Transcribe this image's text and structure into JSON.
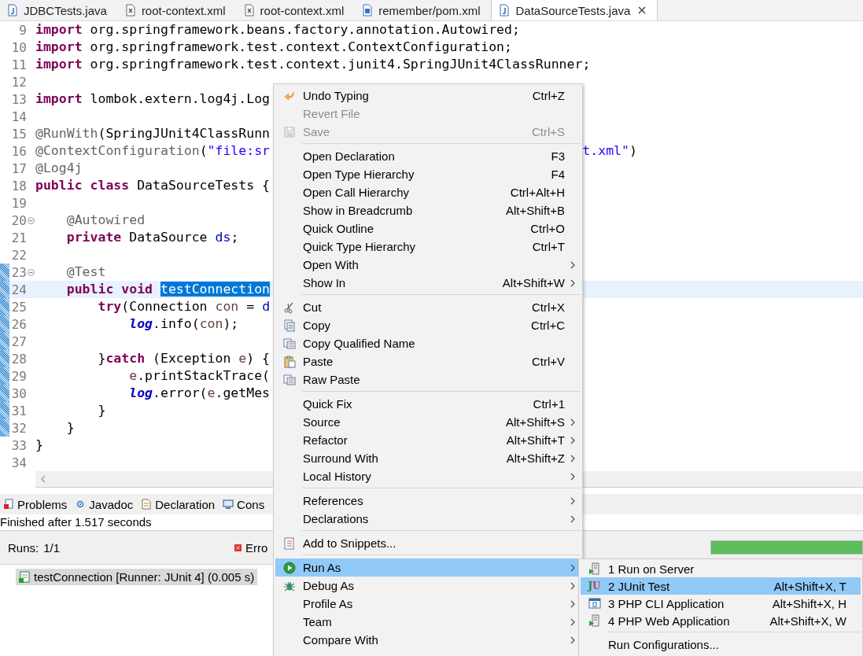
{
  "editor_tabs": [
    {
      "label": "JDBCTests.java",
      "kind": "java",
      "selected": false
    },
    {
      "label": "root-context.xml",
      "kind": "xml",
      "selected": false
    },
    {
      "label": "root-context.xml",
      "kind": "xml",
      "selected": false
    },
    {
      "label": "remember/pom.xml",
      "kind": "maven",
      "selected": false
    },
    {
      "label": "DataSourceTests.java",
      "kind": "java",
      "selected": true
    }
  ],
  "code_lines": [
    {
      "number": "9",
      "changed": false,
      "fold": false,
      "current": false,
      "tokens": [
        {
          "kind": "keyword",
          "text": "import"
        },
        {
          "kind": "plain",
          "text": " org.springframework.beans.factory.annotation.Autowired;"
        }
      ]
    },
    {
      "number": "10",
      "changed": false,
      "fold": false,
      "current": false,
      "tokens": [
        {
          "kind": "keyword",
          "text": "import"
        },
        {
          "kind": "plain",
          "text": " org.springframework.test.context.ContextConfiguration;"
        }
      ]
    },
    {
      "number": "11",
      "changed": false,
      "fold": false,
      "current": false,
      "tokens": [
        {
          "kind": "keyword",
          "text": "import"
        },
        {
          "kind": "plain",
          "text": " org.springframework.test.context.junit4.SpringJUnit4ClassRunner;"
        }
      ]
    },
    {
      "number": "12",
      "changed": false,
      "fold": false,
      "current": false
    },
    {
      "number": "13",
      "changed": false,
      "fold": false,
      "current": false,
      "tokens": [
        {
          "kind": "keyword",
          "text": "import"
        },
        {
          "kind": "plain",
          "text": " lombok.extern.log4j.Log"
        }
      ]
    },
    {
      "number": "14",
      "changed": false,
      "fold": false,
      "current": false
    },
    {
      "number": "15",
      "changed": false,
      "fold": false,
      "current": false,
      "tokens": [
        {
          "kind": "annotation",
          "text": "@RunWith"
        },
        {
          "kind": "plain",
          "text": "(SpringJUnit4ClassRunn"
        }
      ]
    },
    {
      "number": "16",
      "changed": false,
      "fold": false,
      "current": false,
      "tokens": [
        {
          "kind": "annotation",
          "text": "@ContextConfiguration"
        },
        {
          "kind": "plain",
          "text": "("
        },
        {
          "kind": "string",
          "text": "\"file:sr"
        }
      ],
      "tail": [
        {
          "kind": "string",
          "text": "t.xml\""
        },
        {
          "kind": "plain",
          "text": ")"
        }
      ]
    },
    {
      "number": "17",
      "changed": false,
      "fold": false,
      "current": false,
      "tokens": [
        {
          "kind": "annotation",
          "text": "@Log4j"
        }
      ]
    },
    {
      "number": "18",
      "changed": false,
      "fold": false,
      "current": false,
      "tokens": [
        {
          "kind": "keyword",
          "text": "public"
        },
        {
          "kind": "keyword",
          "text": " class"
        },
        {
          "kind": "plain",
          "text": " DataSourceTests {"
        }
      ]
    },
    {
      "number": "19",
      "changed": false,
      "fold": false,
      "current": false
    },
    {
      "number": "20",
      "changed": false,
      "fold": true,
      "current": false,
      "tokens": [
        {
          "kind": "annotation",
          "text": "    @Autowired"
        }
      ]
    },
    {
      "number": "21",
      "changed": false,
      "fold": false,
      "current": false,
      "tokens": [
        {
          "kind": "keyword",
          "text": "    private"
        },
        {
          "kind": "plain",
          "text": " DataSource "
        },
        {
          "kind": "field",
          "text": "ds"
        },
        {
          "kind": "plain",
          "text": ";"
        }
      ]
    },
    {
      "number": "22",
      "changed": false,
      "fold": false,
      "current": false
    },
    {
      "number": "23",
      "changed": true,
      "fold": true,
      "current": false,
      "tokens": [
        {
          "kind": "annotation",
          "text": "    @Test"
        }
      ]
    },
    {
      "number": "24",
      "changed": true,
      "fold": false,
      "current": true,
      "tokens": [
        {
          "kind": "keyword",
          "text": "    public"
        },
        {
          "kind": "keyword",
          "text": " void "
        },
        {
          "kind": "selection",
          "text": "testConnection"
        }
      ]
    },
    {
      "number": "25",
      "changed": true,
      "fold": false,
      "current": false,
      "tokens": [
        {
          "kind": "keyword",
          "text": "        try"
        },
        {
          "kind": "plain",
          "text": "(Connection "
        },
        {
          "kind": "variable",
          "text": "con"
        },
        {
          "kind": "plain",
          "text": " = "
        },
        {
          "kind": "field",
          "text": "d"
        }
      ]
    },
    {
      "number": "26",
      "changed": true,
      "fold": false,
      "current": false,
      "tokens": [
        {
          "kind": "static",
          "text": "            log"
        },
        {
          "kind": "plain",
          "text": ".info("
        },
        {
          "kind": "variable",
          "text": "con"
        },
        {
          "kind": "plain",
          "text": ");"
        }
      ]
    },
    {
      "number": "27",
      "changed": true,
      "fold": false,
      "current": false
    },
    {
      "number": "28",
      "changed": true,
      "fold": false,
      "current": false,
      "tokens": [
        {
          "kind": "plain",
          "text": "        }"
        },
        {
          "kind": "keyword",
          "text": "catch"
        },
        {
          "kind": "plain",
          "text": " (Exception "
        },
        {
          "kind": "variable",
          "text": "e"
        },
        {
          "kind": "plain",
          "text": ") {"
        }
      ]
    },
    {
      "number": "29",
      "changed": true,
      "fold": false,
      "current": false,
      "tokens": [
        {
          "kind": "variable",
          "text": "            e"
        },
        {
          "kind": "plain",
          "text": ".printStackTrace("
        }
      ]
    },
    {
      "number": "30",
      "changed": true,
      "fold": false,
      "current": false,
      "tokens": [
        {
          "kind": "static",
          "text": "            log"
        },
        {
          "kind": "plain",
          "text": ".error("
        },
        {
          "kind": "variable",
          "text": "e"
        },
        {
          "kind": "plain",
          "text": ".getMes"
        }
      ]
    },
    {
      "number": "31",
      "changed": true,
      "fold": false,
      "current": false,
      "tokens": [
        {
          "kind": "plain",
          "text": "        }"
        }
      ]
    },
    {
      "number": "32",
      "changed": true,
      "fold": false,
      "current": false,
      "tokens": [
        {
          "kind": "plain",
          "text": "    }"
        }
      ]
    },
    {
      "number": "33",
      "changed": false,
      "fold": false,
      "current": false,
      "tokens": [
        {
          "kind": "plain",
          "text": "}"
        }
      ]
    },
    {
      "number": "34",
      "changed": false,
      "fold": false,
      "current": false
    }
  ],
  "panel_tabs": [
    {
      "label": "Problems",
      "kind": "problems"
    },
    {
      "label": "Javadoc",
      "kind": "javadoc"
    },
    {
      "label": "Declaration",
      "kind": "declaration"
    },
    {
      "label": "Cons",
      "kind": "console"
    }
  ],
  "junit": {
    "status": "Finished after 1.517 seconds",
    "runs_label": "Runs:",
    "runs_value": "1/1",
    "errors_label": "Erro",
    "progress": {
      "level": 1
    },
    "results": [
      {
        "label": "testConnection [Runner: JUnit 4] (0.005 s)",
        "selected": true
      }
    ]
  },
  "context_menu": [
    {
      "kind": "item",
      "label": "Undo Typing",
      "shortcut": "Ctrl+Z",
      "disabled": false,
      "submenu": false,
      "selected": false
    },
    {
      "kind": "item",
      "label": "Revert File",
      "disabled": true,
      "submenu": false,
      "selected": false
    },
    {
      "kind": "item",
      "label": "Save",
      "shortcut": "Ctrl+S",
      "disabled": true,
      "submenu": false,
      "selected": false
    },
    {
      "kind": "separator"
    },
    {
      "kind": "item",
      "label": "Open Declaration",
      "shortcut": "F3",
      "disabled": false,
      "submenu": false,
      "selected": false
    },
    {
      "kind": "item",
      "label": "Open Type Hierarchy",
      "shortcut": "F4",
      "disabled": false,
      "submenu": false,
      "selected": false
    },
    {
      "kind": "item",
      "label": "Open Call Hierarchy",
      "shortcut": "Ctrl+Alt+H",
      "disabled": false,
      "submenu": false,
      "selected": false
    },
    {
      "kind": "item",
      "label": "Show in Breadcrumb",
      "shortcut": "Alt+Shift+B",
      "disabled": false,
      "submenu": false,
      "selected": false
    },
    {
      "kind": "item",
      "label": "Quick Outline",
      "shortcut": "Ctrl+O",
      "disabled": false,
      "submenu": false,
      "selected": false
    },
    {
      "kind": "item",
      "label": "Quick Type Hierarchy",
      "shortcut": "Ctrl+T",
      "disabled": false,
      "submenu": false,
      "selected": false
    },
    {
      "kind": "item",
      "label": "Open With",
      "disabled": false,
      "submenu": true,
      "selected": false
    },
    {
      "kind": "item",
      "label": "Show In",
      "shortcut": "Alt+Shift+W",
      "disabled": false,
      "submenu": true,
      "selected": false
    },
    {
      "kind": "separator"
    },
    {
      "kind": "item",
      "label": "Cut",
      "shortcut": "Ctrl+X",
      "disabled": false,
      "submenu": false,
      "selected": false
    },
    {
      "kind": "item",
      "label": "Copy",
      "shortcut": "Ctrl+C",
      "disabled": false,
      "submenu": false,
      "selected": false
    },
    {
      "kind": "item",
      "label": "Copy Qualified Name",
      "disabled": false,
      "submenu": false,
      "selected": false
    },
    {
      "kind": "item",
      "label": "Paste",
      "shortcut": "Ctrl+V",
      "disabled": false,
      "submenu": false,
      "selected": false
    },
    {
      "kind": "item",
      "label": "Raw Paste",
      "disabled": false,
      "submenu": false,
      "selected": false
    },
    {
      "kind": "separator"
    },
    {
      "kind": "item",
      "label": "Quick Fix",
      "shortcut": "Ctrl+1",
      "disabled": false,
      "submenu": false,
      "selected": false
    },
    {
      "kind": "item",
      "label": "Source",
      "shortcut": "Alt+Shift+S",
      "disabled": false,
      "submenu": true,
      "selected": false
    },
    {
      "kind": "item",
      "label": "Refactor",
      "shortcut": "Alt+Shift+T",
      "disabled": false,
      "submenu": true,
      "selected": false
    },
    {
      "kind": "item",
      "label": "Surround With",
      "shortcut": "Alt+Shift+Z",
      "disabled": false,
      "submenu": true,
      "selected": false
    },
    {
      "kind": "item",
      "label": "Local History",
      "disabled": false,
      "submenu": true,
      "selected": false
    },
    {
      "kind": "separator"
    },
    {
      "kind": "item",
      "label": "References",
      "disabled": false,
      "submenu": true,
      "selected": false
    },
    {
      "kind": "item",
      "label": "Declarations",
      "disabled": false,
      "submenu": true,
      "selected": false
    },
    {
      "kind": "separator"
    },
    {
      "kind": "item",
      "label": "Add to Snippets...",
      "disabled": false,
      "submenu": false,
      "selected": false
    },
    {
      "kind": "separator"
    },
    {
      "kind": "item",
      "label": "Run As",
      "disabled": false,
      "submenu": true,
      "selected": true
    },
    {
      "kind": "item",
      "label": "Debug As",
      "disabled": false,
      "submenu": true,
      "selected": false
    },
    {
      "kind": "item",
      "label": "Profile As",
      "disabled": false,
      "submenu": true,
      "selected": false
    },
    {
      "kind": "item",
      "label": "Team",
      "disabled": false,
      "submenu": true,
      "selected": false
    },
    {
      "kind": "item",
      "label": "Compare With",
      "disabled": false,
      "submenu": true,
      "selected": false
    }
  ],
  "run_as_submenu": [
    {
      "kind": "item",
      "label": "1 Run on Server",
      "selected": false
    },
    {
      "kind": "item",
      "label": "2 JUnit Test",
      "shortcut": "Alt+Shift+X, T",
      "icon_text": "JU",
      "selected": true
    },
    {
      "kind": "item",
      "label": "3 PHP CLI Application",
      "shortcut": "Alt+Shift+X, H",
      "selected": false
    },
    {
      "kind": "item",
      "label": "4 PHP Web Application",
      "shortcut": "Alt+Shift+X, W",
      "selected": false
    },
    {
      "kind": "separator"
    },
    {
      "kind": "item",
      "label": "Run Configurations...",
      "selected": false
    }
  ]
}
